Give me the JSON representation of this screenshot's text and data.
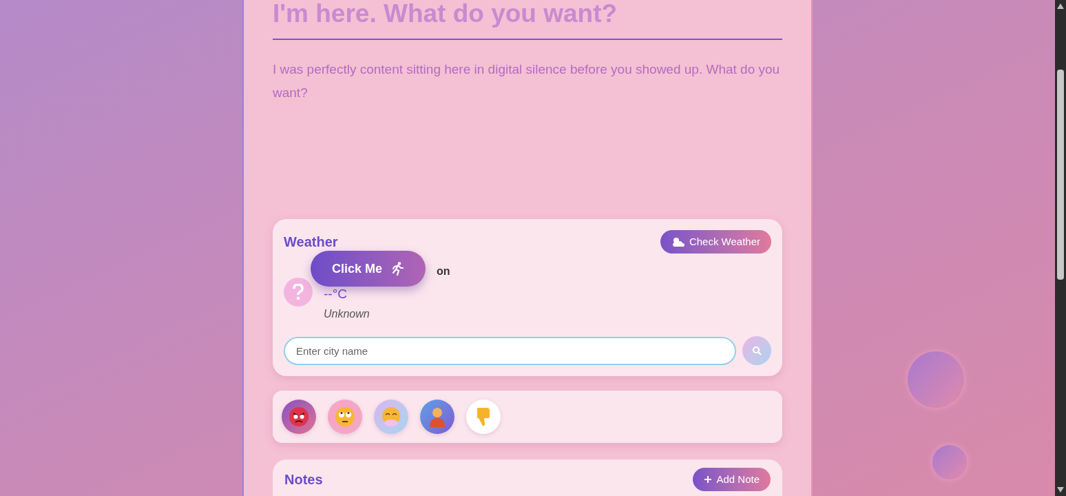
{
  "heading": "I'm here. What do you want?",
  "message": "I was perfectly content sitting here in digital silence before you showed up. What do you want?",
  "weather": {
    "title": "Weather",
    "check_button": "Check Weather",
    "location": "on",
    "temperature": "--°C",
    "condition": "Unknown",
    "city_input": {
      "placeholder": "Enter city name"
    }
  },
  "floating_button": "Click Me",
  "reactions": [
    {
      "kind": "angry"
    },
    {
      "kind": "eye-roll"
    },
    {
      "kind": "sigh"
    },
    {
      "kind": "person"
    },
    {
      "kind": "thumbs-down"
    }
  ],
  "notes": {
    "title": "Notes",
    "add_button": "Add Note"
  }
}
